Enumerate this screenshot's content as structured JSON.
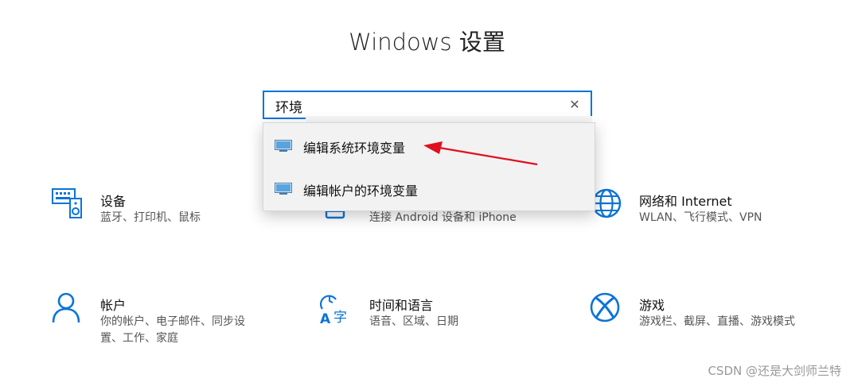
{
  "window": {
    "title": "Windows 设置"
  },
  "search": {
    "value": "环境",
    "clear_icon": "close-icon"
  },
  "dropdown": {
    "items": [
      {
        "label": "编辑系统环境变量",
        "icon": "monitor-icon"
      },
      {
        "label": "编辑帐户的环境变量",
        "icon": "monitor-icon"
      }
    ]
  },
  "categories": [
    {
      "name": "设备",
      "desc": "蓝牙、打印机、鼠标",
      "icon": "keyboard-speaker-icon"
    },
    {
      "name": "",
      "desc": "连接 Android 设备和 iPhone",
      "icon": "phone-icon"
    },
    {
      "name": "网络和 Internet",
      "desc": "WLAN、飞行模式、VPN",
      "icon": "globe-icon"
    },
    {
      "name": "帐户",
      "desc_lines": [
        "你的帐户、电子邮件、同步设",
        "置、工作、家庭"
      ],
      "icon": "person-icon"
    },
    {
      "name": "时间和语言",
      "desc": "语音、区域、日期",
      "icon": "time-language-icon"
    },
    {
      "name": "游戏",
      "desc": "游戏栏、截屏、直播、游戏模式",
      "icon": "xbox-icon"
    }
  ],
  "watermark": "CSDN @还是大剑师兰特",
  "colors": {
    "accent": "#0a74d8",
    "arrow": "#e0101e"
  }
}
